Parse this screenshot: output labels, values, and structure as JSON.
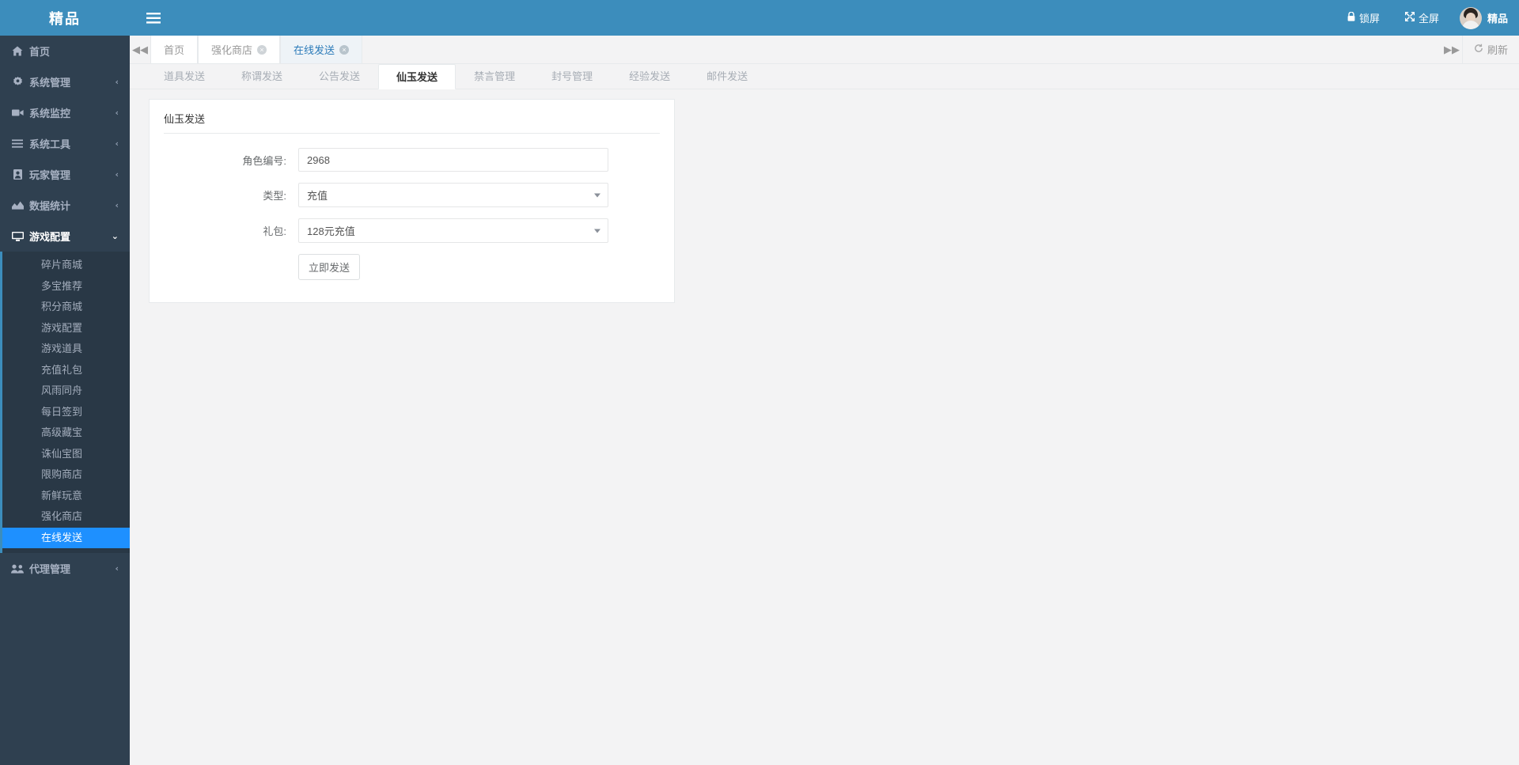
{
  "brand": {
    "title": "精品"
  },
  "topbar": {
    "hamburger_icon": "hamburger-icon",
    "lock_label": "锁屏",
    "lock_icon": "lock-icon",
    "fullscreen_label": "全屏",
    "fullscreen_icon": "expand-icon",
    "user_name": "精品"
  },
  "sidebar": {
    "items": [
      {
        "label": "首页",
        "icon": "home-icon",
        "arrow": "",
        "open": false
      },
      {
        "label": "系统管理",
        "icon": "gear-icon",
        "arrow": "‹",
        "open": false
      },
      {
        "label": "系统监控",
        "icon": "video-icon",
        "arrow": "‹",
        "open": false
      },
      {
        "label": "系统工具",
        "icon": "list-icon",
        "arrow": "‹",
        "open": false
      },
      {
        "label": "玩家管理",
        "icon": "user-card-icon",
        "arrow": "‹",
        "open": false
      },
      {
        "label": "数据统计",
        "icon": "chart-icon",
        "arrow": "‹",
        "open": false
      },
      {
        "label": "游戏配置",
        "icon": "desktop-icon",
        "arrow": "⌄",
        "open": true
      },
      {
        "label": "代理管理",
        "icon": "users-icon",
        "arrow": "‹",
        "open": false
      }
    ],
    "submenu": [
      {
        "label": "碎片商城",
        "active": false
      },
      {
        "label": "多宝推荐",
        "active": false
      },
      {
        "label": "积分商城",
        "active": false
      },
      {
        "label": "游戏配置",
        "active": false
      },
      {
        "label": "游戏道具",
        "active": false
      },
      {
        "label": "充值礼包",
        "active": false
      },
      {
        "label": "风雨同舟",
        "active": false
      },
      {
        "label": "每日签到",
        "active": false
      },
      {
        "label": "高级藏宝",
        "active": false
      },
      {
        "label": "诛仙宝图",
        "active": false
      },
      {
        "label": "限购商店",
        "active": false
      },
      {
        "label": "新鲜玩意",
        "active": false
      },
      {
        "label": "强化商店",
        "active": false
      },
      {
        "label": "在线发送",
        "active": true
      }
    ]
  },
  "tabstrip": {
    "prev_icon": "chevron-double-left-icon",
    "next_icon": "chevron-double-right-icon",
    "refresh_label": "刷新",
    "refresh_icon": "refresh-icon",
    "close_glyph": "×",
    "tabs": [
      {
        "label": "首页",
        "closable": false,
        "active": false
      },
      {
        "label": "强化商店",
        "closable": true,
        "active": false
      },
      {
        "label": "在线发送",
        "closable": true,
        "active": true
      }
    ]
  },
  "content_tabs": [
    {
      "label": "道具发送",
      "active": false
    },
    {
      "label": "称谓发送",
      "active": false
    },
    {
      "label": "公告发送",
      "active": false
    },
    {
      "label": "仙玉发送",
      "active": true
    },
    {
      "label": "禁言管理",
      "active": false
    },
    {
      "label": "封号管理",
      "active": false
    },
    {
      "label": "经验发送",
      "active": false
    },
    {
      "label": "邮件发送",
      "active": false
    }
  ],
  "panel": {
    "title": "仙玉发送",
    "fields": {
      "role_id_label": "角色编号:",
      "role_id_value": "2968",
      "role_id_placeholder": "",
      "type_label": "类型:",
      "type_value": "充值",
      "gift_label": "礼包:",
      "gift_value": "128元充值"
    },
    "submit_label": "立即发送"
  },
  "colors": {
    "header_blue": "#3c8dbc",
    "sidebar_dark": "#2f4050",
    "submenu_dark": "#293846",
    "active_blue": "#1E90FF",
    "tab_active_blue": "#2b7bb9"
  }
}
